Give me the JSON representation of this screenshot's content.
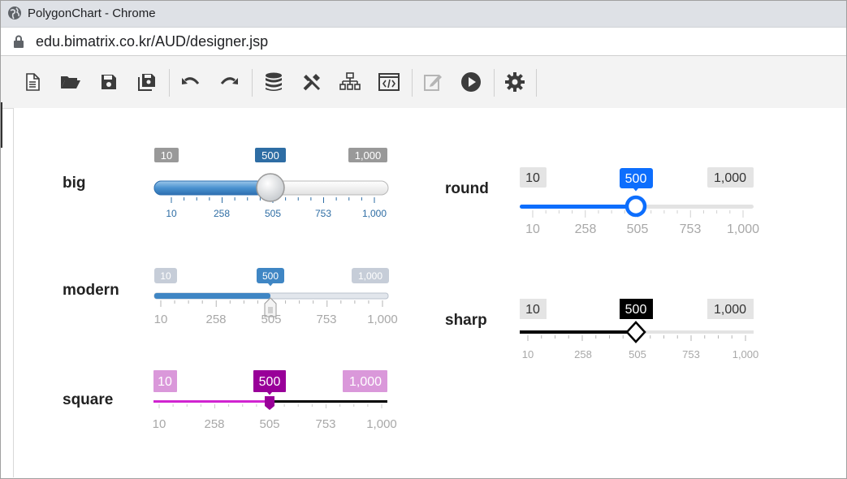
{
  "window": {
    "title": "PolygonChart - Chrome"
  },
  "address_bar": {
    "url": "edu.bimatrix.co.kr/AUD/designer.jsp"
  },
  "toolbar": {
    "buttons": [
      "new-document-icon",
      "open-folder-icon",
      "save-icon",
      "save-all-icon",
      "undo-icon",
      "redo-icon",
      "database-icon",
      "tools-icon",
      "hierarchy-icon",
      "code-icon",
      "edit-icon",
      "play-icon",
      "settings-icon"
    ]
  },
  "sliders": [
    {
      "id": "big",
      "label": "big",
      "min_label": "10",
      "max_label": "1,000",
      "value_label": "500",
      "value_fraction": 0.495,
      "ticks": [
        "10",
        "258",
        "505",
        "753",
        "1,000"
      ],
      "colors": {
        "fill": "#3f86c4",
        "value_badge": "#2e6da4",
        "minmax_badge": "#999999",
        "tick_text": "#2e6da4"
      }
    },
    {
      "id": "modern",
      "label": "modern",
      "min_label": "10",
      "max_label": "1,000",
      "value_label": "500",
      "value_fraction": 0.495,
      "ticks": [
        "10",
        "258",
        "505",
        "753",
        "1,000"
      ],
      "colors": {
        "fill": "#3f86c4",
        "value_badge": "#3f86c4",
        "minmax_badge": "#c6cdd8",
        "tick_text": "#a8a8a8"
      }
    },
    {
      "id": "square",
      "label": "square",
      "min_label": "10",
      "max_label": "1,000",
      "value_label": "500",
      "value_fraction": 0.495,
      "ticks": [
        "10",
        "258",
        "505",
        "753",
        "1,000"
      ],
      "colors": {
        "fill": "#d024d0",
        "value_badge": "#990099",
        "minmax_badge": "#da98da",
        "tick_text": "#a8a8a8"
      }
    },
    {
      "id": "round",
      "label": "round",
      "min_label": "10",
      "max_label": "1,000",
      "value_label": "500",
      "value_fraction": 0.495,
      "ticks": [
        "10",
        "258",
        "505",
        "753",
        "1,000"
      ],
      "colors": {
        "fill": "#0d6efd",
        "value_badge": "#0d6efd",
        "minmax_badge": "#e4e4e4",
        "tick_text": "#a8a8a8"
      }
    },
    {
      "id": "sharp",
      "label": "sharp",
      "min_label": "10",
      "max_label": "1,000",
      "value_label": "500",
      "value_fraction": 0.495,
      "ticks": [
        "10",
        "258",
        "505",
        "753",
        "1,000"
      ],
      "colors": {
        "fill": "#000000",
        "value_badge": "#000000",
        "minmax_badge": "#e4e4e4",
        "tick_text": "#a8a8a8"
      }
    }
  ]
}
